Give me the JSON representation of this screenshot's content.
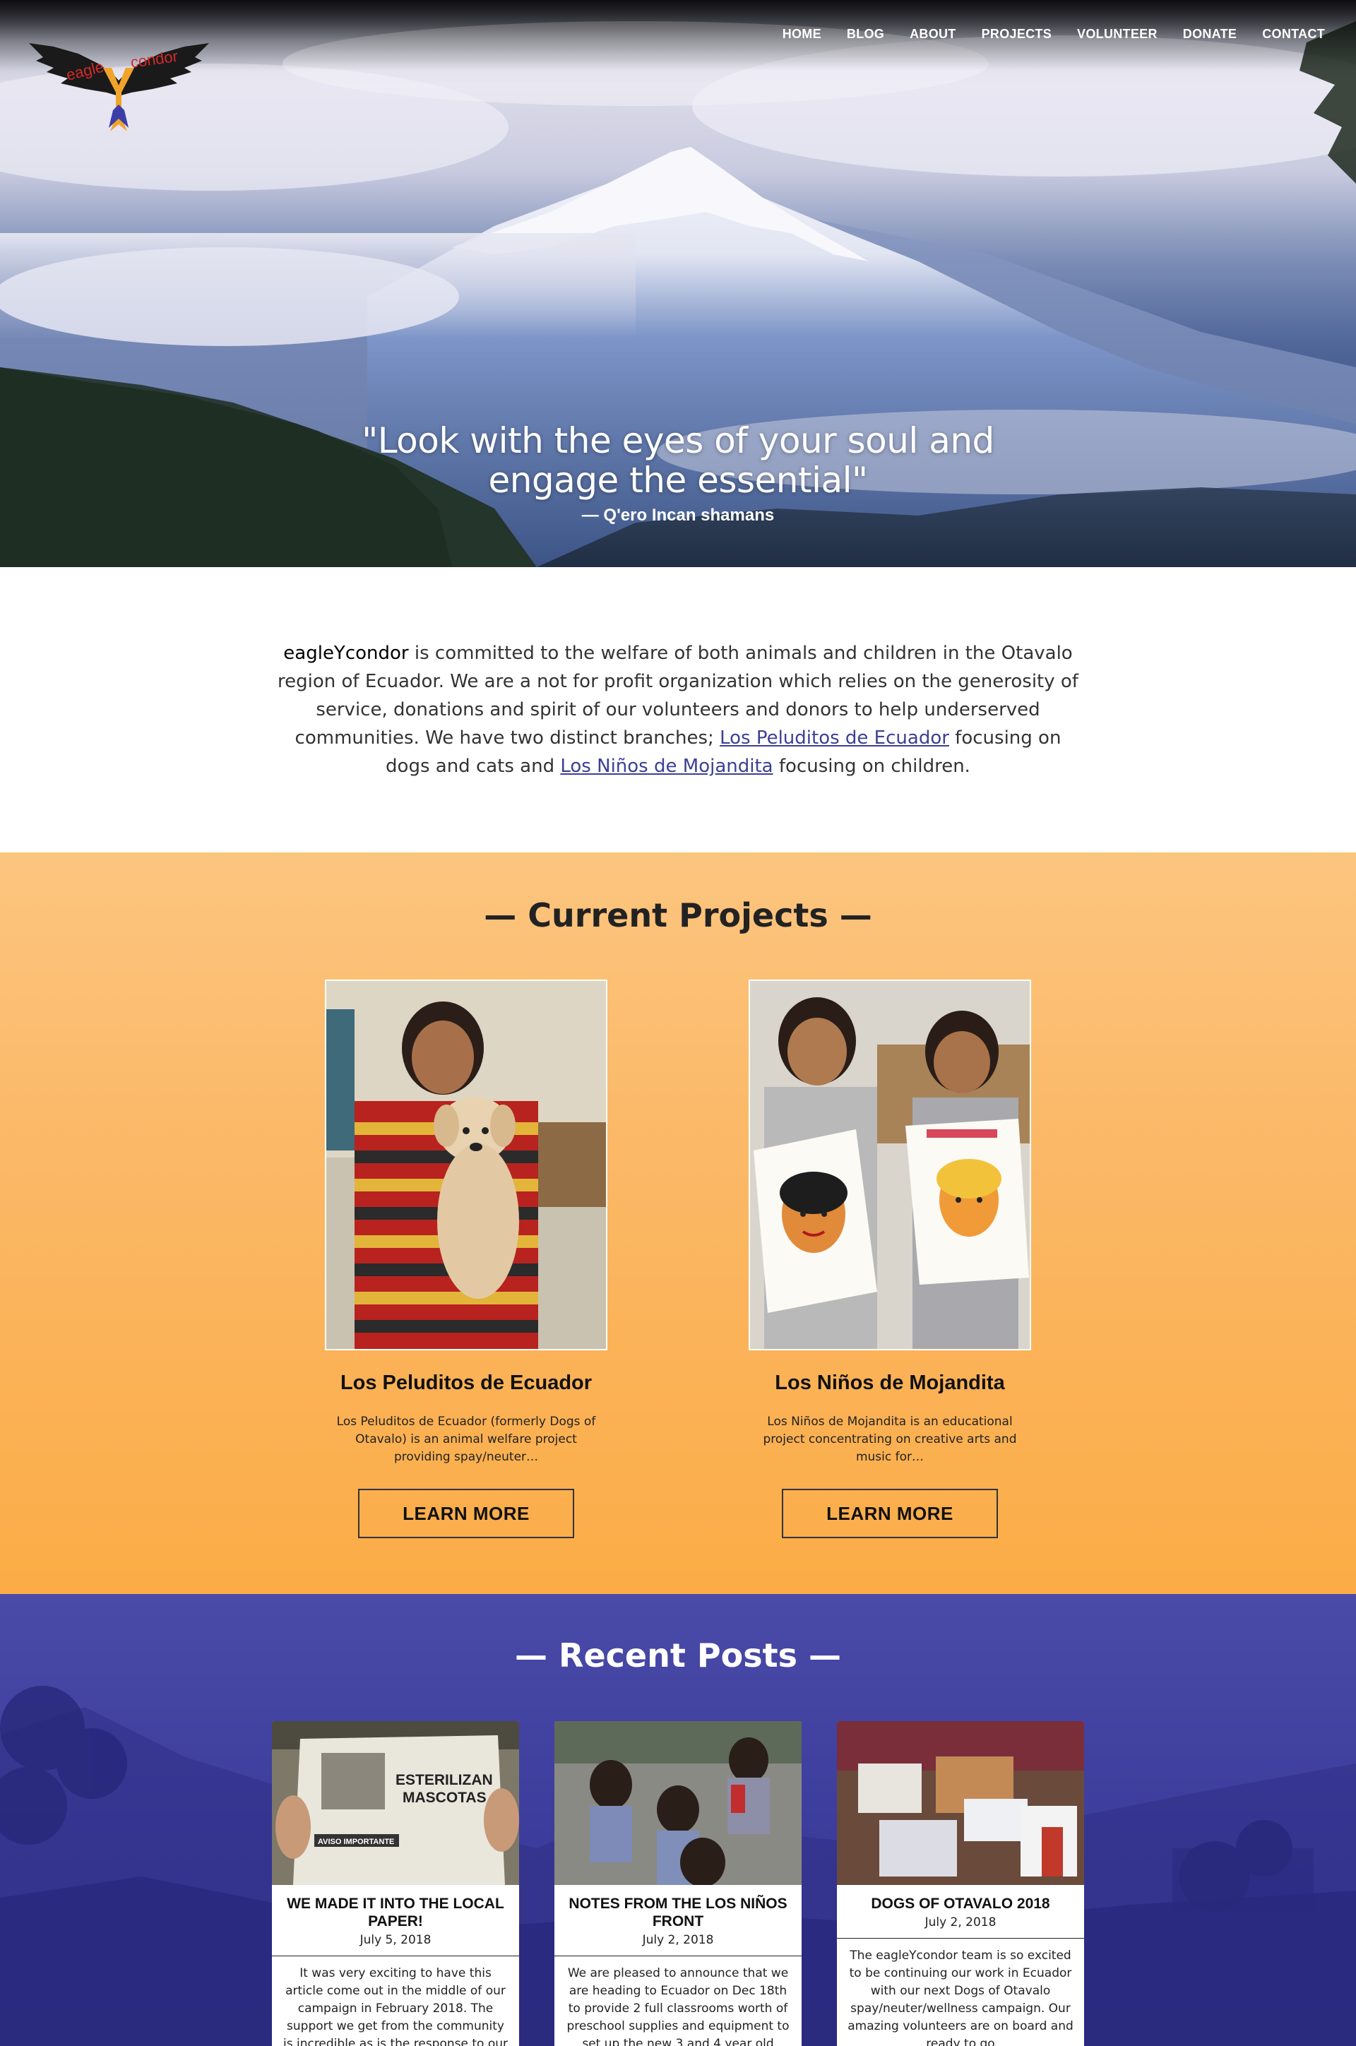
{
  "logo": {
    "text_left": "eagle",
    "text_mid": "Y",
    "text_right": "condor",
    "alt": "eagleYcondor"
  },
  "nav": [
    "HOME",
    "BLOG",
    "ABOUT",
    "PROJECTS",
    "VOLUNTEER",
    "DONATE",
    "CONTACT"
  ],
  "hero": {
    "quote_line1": "\"Look with the eyes of your soul and",
    "quote_line2": "engage the essential\"",
    "attribution": "— Q'ero Incan shamans"
  },
  "intro": {
    "brand": "eagleYcondor",
    "text1": " is committed to the welfare of both animals and children in the Otavalo region of Ecuador. We are a not for profit organization which relies on the generosity of service, donations and spirit of our volunteers and donors to help underserved communities. We have two distinct branches; ",
    "link1": "Los Peluditos de Ecuador",
    "text2": " focusing on dogs and cats and ",
    "link2": "Los Niños de Mojandita",
    "text3": " focusing on children."
  },
  "projects": {
    "title": "— Current Projects —",
    "items": [
      {
        "name": "Los Peluditos de Ecuador",
        "description": "Los Peluditos de Ecuador (formerly Dogs of Otavalo) is an animal welfare project providing spay/neuter…",
        "button": "LEARN MORE"
      },
      {
        "name": "Los Niños de Mojandita",
        "description": "Los Niños de Mojandita is an educational project concentrating on creative arts and music for…",
        "button": "LEARN MORE"
      }
    ]
  },
  "posts": {
    "title": "— Recent Posts —",
    "items": [
      {
        "title": "WE MADE IT INTO THE LOCAL PAPER!",
        "date": "July 5, 2018",
        "excerpt": "It was very exciting to have this article come out in the middle of our campaign in February 2018. The support we get from the community is incredible as is the response to our",
        "thumb_text1": "ESTERILIZAN",
        "thumb_text2": "MASCOTAS",
        "thumb_text3": "AVISO IMPORTANTE"
      },
      {
        "title": "NOTES FROM THE LOS NIÑOS FRONT",
        "date": "July 2, 2018",
        "excerpt": "We are pleased to announce that we are heading to Ecuador on Dec 18th to provide 2 full classrooms worth of preschool supplies and equipment to set up the new 3 and 4 year old"
      },
      {
        "title": "DOGS OF OTAVALO 2018",
        "date": "July 2, 2018",
        "excerpt": "The eagleYcondor team is so excited to be continuing our work in Ecuador with our next Dogs of Otavalo spay/neuter/wellness campaign. Our amazing volunteers are on board and ready to go"
      }
    ]
  },
  "colors": {
    "projects_bg": "#fbb35a",
    "posts_bg": "#3d3d9d",
    "link": "#3d3f95"
  }
}
